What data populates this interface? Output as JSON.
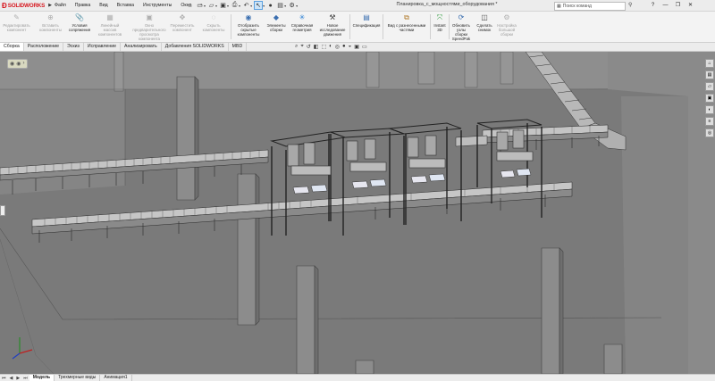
{
  "app": {
    "logo": "SOLIDWORKS",
    "document_title": "Планировка_с_мощностями_оборудования *"
  },
  "menu": [
    "Файл",
    "Правка",
    "Вид",
    "Вставка",
    "Инструменты",
    "Окно"
  ],
  "search": {
    "placeholder": "Поиск команд"
  },
  "ribbon": [
    {
      "label": "Редактировать компонент",
      "enabled": false,
      "icon": "edit-component-icon"
    },
    {
      "label": "Вставить компоненты",
      "enabled": false,
      "icon": "insert-components-icon"
    },
    {
      "label": "Условия сопряжения",
      "enabled": true,
      "icon": "mate-icon"
    },
    {
      "label": "Линейный массив компонентов",
      "enabled": false,
      "icon": "linear-pattern-icon"
    },
    {
      "label": "Окно предварительного просмотра компонента",
      "enabled": false,
      "icon": "preview-window-icon"
    },
    {
      "label": "Переместить компонент",
      "enabled": false,
      "icon": "move-component-icon"
    },
    {
      "label": "Скрыть компоненты",
      "enabled": false,
      "icon": "hide-components-icon"
    },
    {
      "label": "Отобразить скрытые компоненты",
      "enabled": true,
      "icon": "show-hidden-icon"
    },
    {
      "label": "Элементы сборки",
      "enabled": true,
      "icon": "assembly-features-icon"
    },
    {
      "label": "Справочная геометрия",
      "enabled": true,
      "icon": "reference-geometry-icon"
    },
    {
      "label": "Новое исследование движения",
      "enabled": true,
      "icon": "motion-study-icon"
    },
    {
      "label": "Спецификация",
      "enabled": true,
      "icon": "bom-icon"
    },
    {
      "label": "Вид с разнесенными частями",
      "enabled": true,
      "icon": "exploded-view-icon"
    },
    {
      "label": "Instant 3D",
      "enabled": true,
      "icon": "instant3d-icon"
    },
    {
      "label": "Обновить узлы сборки SpeedPak",
      "enabled": true,
      "icon": "speedpak-icon"
    },
    {
      "label": "Сделать снимок",
      "enabled": true,
      "icon": "snapshot-icon"
    },
    {
      "label": "Настройка большой сборки",
      "enabled": false,
      "icon": "large-assembly-icon"
    }
  ],
  "tabs": [
    "Сборка",
    "Расположение",
    "Эскиз",
    "Исправление",
    "Анализировать",
    "Добавления SOLIDWORKS",
    "MBD"
  ],
  "active_tab": "Сборка",
  "status_tabs": [
    "Модель",
    "Трехмерные виды",
    "Анимация1"
  ],
  "active_status_tab": "Модель",
  "colors": {
    "floor": "#7d7d7d",
    "wall": "#909090",
    "pillar": "#8a8a8a",
    "accent": "#d71920",
    "highlight": "#4a90d9"
  }
}
